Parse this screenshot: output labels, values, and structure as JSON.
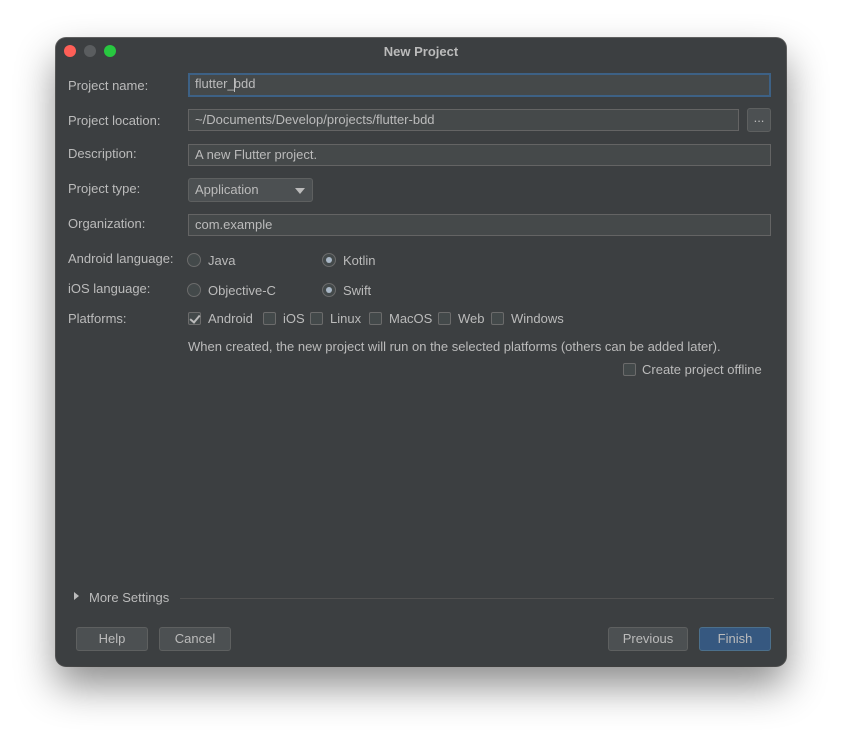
{
  "window": {
    "title": "New Project"
  },
  "form": {
    "project_name_label": "Project name:",
    "project_name_before_caret": "flutter_",
    "project_name_after_caret": "bdd",
    "project_location_label": "Project location:",
    "project_location_value": "~/Documents/Develop/projects/flutter-bdd",
    "browse_label": "...",
    "description_label": "Description:",
    "description_value": "A new Flutter project.",
    "project_type_label": "Project type:",
    "project_type_value": "Application",
    "organization_label": "Organization:",
    "organization_value": "com.example",
    "android_language_label": "Android language:",
    "android_options": [
      {
        "label": "Java",
        "selected": false
      },
      {
        "label": "Kotlin",
        "selected": true
      }
    ],
    "ios_language_label": "iOS language:",
    "ios_options": [
      {
        "label": "Objective-C",
        "selected": false
      },
      {
        "label": "Swift",
        "selected": true
      }
    ],
    "platforms_label": "Platforms:",
    "platforms": [
      {
        "label": "Android",
        "checked": true
      },
      {
        "label": "iOS",
        "checked": false
      },
      {
        "label": "Linux",
        "checked": false
      },
      {
        "label": "MacOS",
        "checked": false
      },
      {
        "label": "Web",
        "checked": false
      },
      {
        "label": "Windows",
        "checked": false
      }
    ],
    "platforms_info": "When created, the new project will run on the selected platforms (others can be added later).",
    "offline_label": "Create project offline",
    "offline_checked": false
  },
  "more_settings_label": "More Settings",
  "buttons": {
    "help": "Help",
    "cancel": "Cancel",
    "previous": "Previous",
    "finish": "Finish"
  },
  "colors": {
    "background": "#3c3f41",
    "field": "#45494a",
    "focus_border": "#3d6185",
    "primary_button": "#365880",
    "text": "#bbbbbb"
  }
}
